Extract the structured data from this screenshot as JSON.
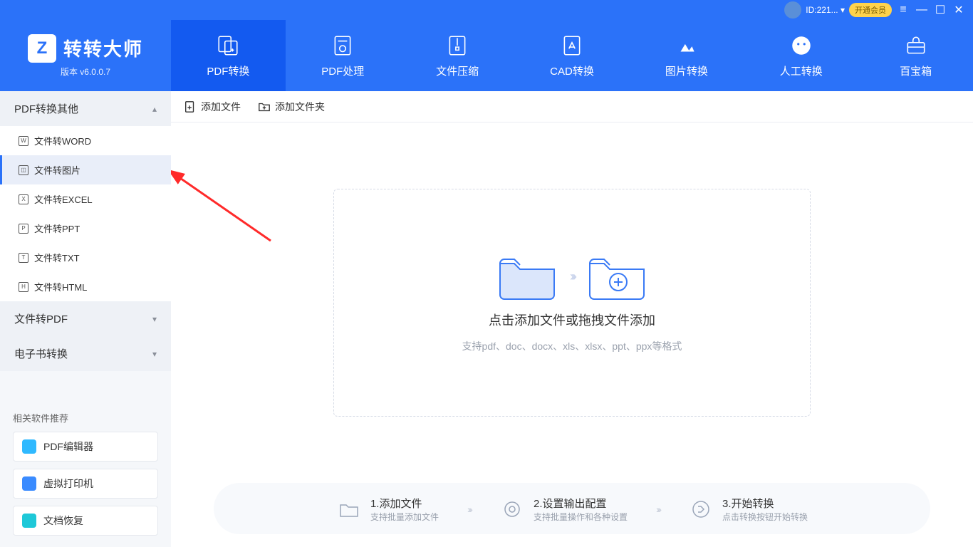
{
  "titlebar": {
    "uid": "ID:221... ▾",
    "vip": "开通会员"
  },
  "brand": {
    "logo_letter": "Z",
    "title": "转转大师",
    "version": "版本 v6.0.0.7"
  },
  "nav": [
    {
      "label": "PDF转换",
      "active": true
    },
    {
      "label": "PDF处理",
      "active": false
    },
    {
      "label": "文件压缩",
      "active": false
    },
    {
      "label": "CAD转换",
      "active": false
    },
    {
      "label": "图片转换",
      "active": false
    },
    {
      "label": "人工转换",
      "active": false
    },
    {
      "label": "百宝箱",
      "active": false
    }
  ],
  "sidebar": {
    "sections": [
      {
        "title": "PDF转换其他",
        "expanded": true,
        "items": [
          {
            "label": "文件转WORD",
            "glyph": "W",
            "selected": false
          },
          {
            "label": "文件转图片",
            "glyph": "◫",
            "selected": true
          },
          {
            "label": "文件转EXCEL",
            "glyph": "X",
            "selected": false
          },
          {
            "label": "文件转PPT",
            "glyph": "P",
            "selected": false
          },
          {
            "label": "文件转TXT",
            "glyph": "T",
            "selected": false
          },
          {
            "label": "文件转HTML",
            "glyph": "H",
            "selected": false
          }
        ]
      },
      {
        "title": "文件转PDF",
        "expanded": false,
        "items": []
      },
      {
        "title": "电子书转换",
        "expanded": false,
        "items": []
      }
    ],
    "promo_title": "相关软件推荐",
    "promos": [
      {
        "label": "PDF编辑器",
        "color": "#2fb9ff"
      },
      {
        "label": "虚拟打印机",
        "color": "#3a8bff"
      },
      {
        "label": "文档恢复",
        "color": "#1ec8d8"
      }
    ]
  },
  "toolbar": {
    "add_file": "添加文件",
    "add_folder": "添加文件夹"
  },
  "drop": {
    "main": "点击添加文件或拖拽文件添加",
    "sub": "支持pdf、doc、docx、xls、xlsx、ppt、ppx等格式"
  },
  "steps": [
    {
      "title": "1.添加文件",
      "sub": "支持批量添加文件"
    },
    {
      "title": "2.设置输出配置",
      "sub": "支持批量操作和各种设置"
    },
    {
      "title": "3.开始转换",
      "sub": "点击转换按钮开始转换"
    }
  ]
}
